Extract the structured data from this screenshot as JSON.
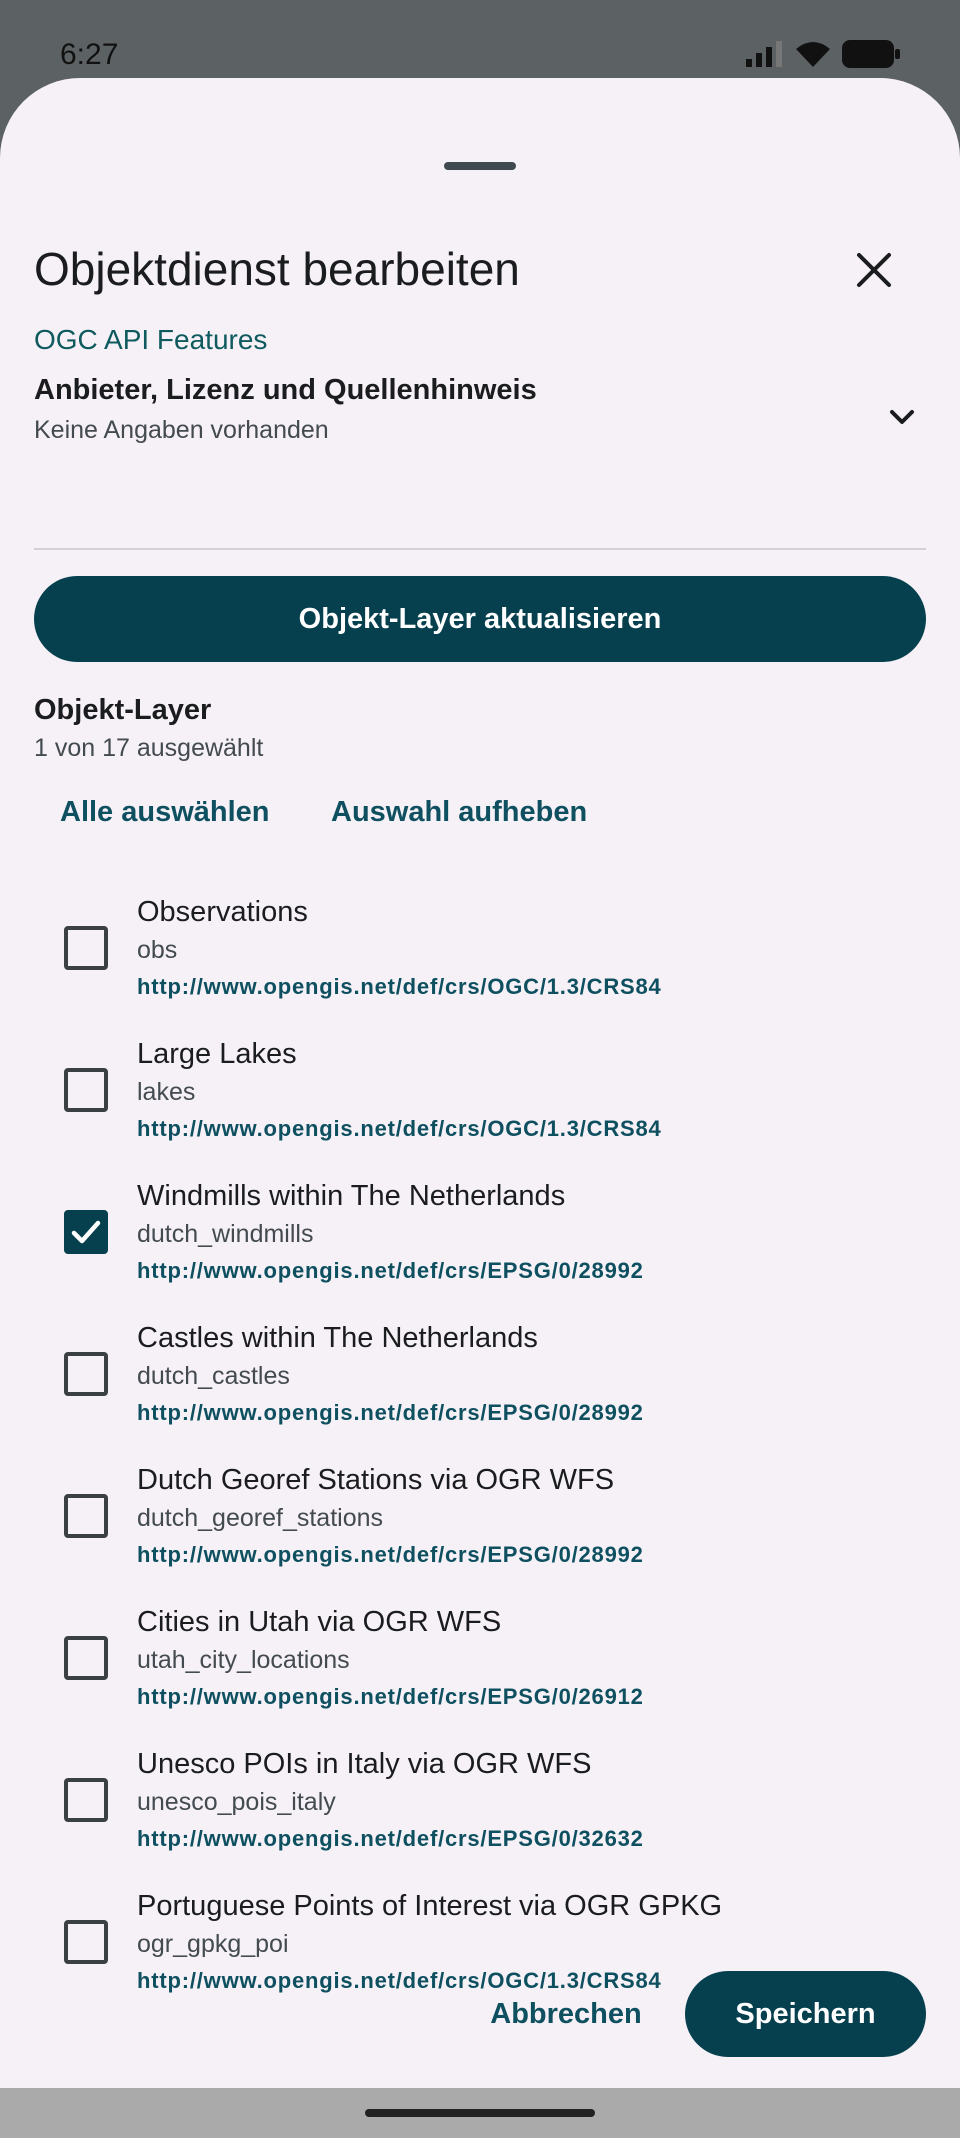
{
  "status": {
    "time": "6:27"
  },
  "dialog": {
    "title": "Objektdienst bearbeiten",
    "service_type": "OGC API Features",
    "provider_title": "Anbieter, Lizenz und Quellenhinweis",
    "provider_sub": "Keine Angaben vorhanden",
    "update_label": "Objekt-Layer aktualisieren",
    "section_title": "Objekt-Layer",
    "section_sub": "1 von 17 ausgewählt",
    "select_all_label": "Alle auswählen",
    "deselect_label": "Auswahl aufheben",
    "cancel_label": "Abbrechen",
    "save_label": "Speichern"
  },
  "layers": [
    {
      "name": "Observations",
      "id": "obs",
      "crs": "http://www.opengis.net/def/crs/OGC/1.3/CRS84",
      "checked": false
    },
    {
      "name": "Large Lakes",
      "id": "lakes",
      "crs": "http://www.opengis.net/def/crs/OGC/1.3/CRS84",
      "checked": false
    },
    {
      "name": "Windmills within The Netherlands",
      "id": "dutch_windmills",
      "crs": "http://www.opengis.net/def/crs/EPSG/0/28992",
      "checked": true
    },
    {
      "name": "Castles within The Netherlands",
      "id": "dutch_castles",
      "crs": "http://www.opengis.net/def/crs/EPSG/0/28992",
      "checked": false
    },
    {
      "name": "Dutch Georef Stations via OGR WFS",
      "id": "dutch_georef_stations",
      "crs": "http://www.opengis.net/def/crs/EPSG/0/28992",
      "checked": false
    },
    {
      "name": "Cities in Utah via OGR WFS",
      "id": "utah_city_locations",
      "crs": "http://www.opengis.net/def/crs/EPSG/0/26912",
      "checked": false
    },
    {
      "name": "Unesco POIs in Italy via OGR WFS",
      "id": "unesco_pois_italy",
      "crs": "http://www.opengis.net/def/crs/EPSG/0/32632",
      "checked": false
    },
    {
      "name": "Portuguese Points of Interest via OGR GPKG",
      "id": "ogr_gpkg_poi",
      "crs": "http://www.opengis.net/def/crs/OGC/1.3/CRS84",
      "checked": false
    }
  ]
}
